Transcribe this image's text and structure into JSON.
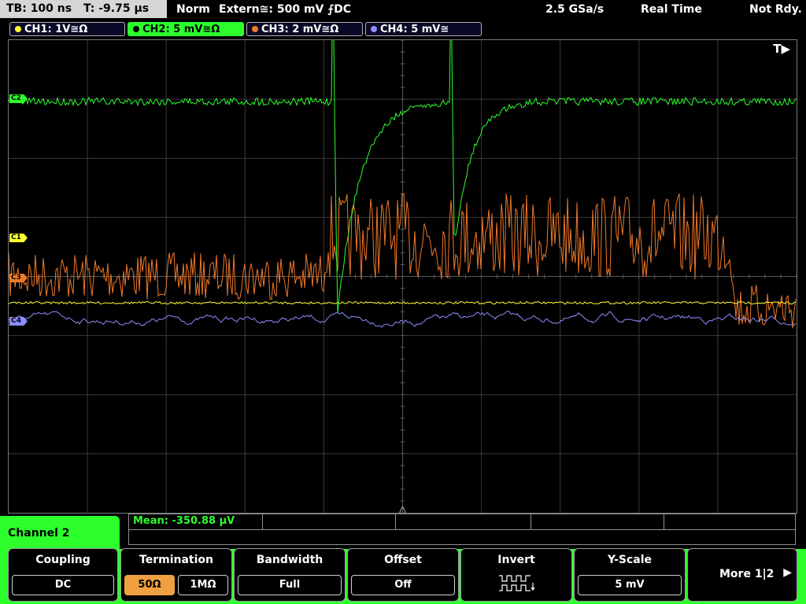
{
  "status": {
    "timebase": "TB: 100 ns",
    "trigger_time": "T: -9.75 µs",
    "mode": "Norm",
    "trigger_source": "Extern≅: 500 mV ⨍DC",
    "sample_rate": "2.5 GSa/s",
    "acq_mode": "Real Time",
    "status": "Not Rdy."
  },
  "channels": [
    {
      "label": "CH1: 1V≅Ω",
      "color": "#ffff30",
      "active": false
    },
    {
      "label": "CH2: 5 mV≅Ω",
      "color": "#2dff2d",
      "active": true
    },
    {
      "label": "CH3: 2 mV≅Ω",
      "color": "#f07828",
      "active": false
    },
    {
      "label": "CH4: 5 mV≅",
      "color": "#8c8cff",
      "active": false
    }
  ],
  "markers": {
    "c1": "C1",
    "c2": "C2",
    "c3": "C3",
    "c4": "C4",
    "trigger_tag": "T▶"
  },
  "measurement": {
    "mean": "Mean: -350.88 µV"
  },
  "menu": {
    "channel_title": "Channel 2",
    "coupling": {
      "title": "Coupling",
      "value": "DC"
    },
    "termination": {
      "title": "Termination",
      "opt1": "50Ω",
      "opt2": "1MΩ"
    },
    "bandwidth": {
      "title": "Bandwidth",
      "value": "Full"
    },
    "offset": {
      "title": "Offset",
      "value": "Off"
    },
    "invert": {
      "title": "Invert"
    },
    "yscale": {
      "title": "Y-Scale",
      "value": "5 mV"
    },
    "more": {
      "label": "More 1|2",
      "arrow": "▶"
    }
  },
  "colors": {
    "ch1": "#ffff30",
    "ch2": "#2dff2d",
    "ch3": "#f07828",
    "ch4": "#8c8cff",
    "grid": "#3a3a3a"
  }
}
